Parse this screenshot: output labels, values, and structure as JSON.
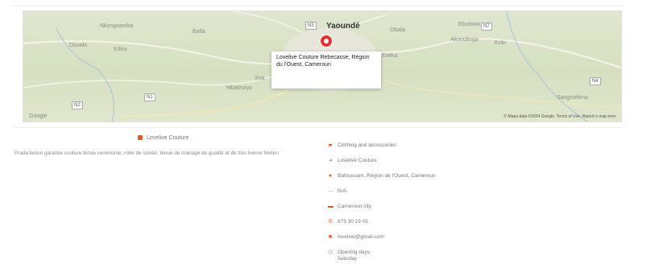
{
  "map": {
    "main_city": "Yaoundé",
    "info_window_title": "Lovelive Couture Rebecasse, Région du l'Ouest, Cameroun",
    "cities": [
      "Douala",
      "Edéa",
      "Nkongsamba",
      "Bafia",
      "Obala",
      "Soa",
      "Mbalmayo",
      "Ebolowa",
      "Akonolinga",
      "Sangmélima",
      "Kribi",
      "Eséka"
    ],
    "highway_markers": [
      "N3",
      "N1",
      "N2",
      "N4",
      "N7"
    ],
    "google_label": "Google",
    "attribution": "© Mapa data ©2024 Google, Terms of Use, Report a map error"
  },
  "listing": {
    "title": "Lovelive Couture",
    "description": "Prada kelvin garantie couture tenue ceremonie, robe de soirée, tenue de mariage de qualité et de tres bonne finition"
  },
  "details": {
    "items": [
      {
        "icon": "briefcase-icon",
        "text": "Clothing and accessories"
      },
      {
        "icon": "tag-icon",
        "text": "Lovelive Couture"
      },
      {
        "icon": "location-icon",
        "text": "Bafoussam, Région de l'Ouest, Cameroun"
      },
      {
        "icon": "flag-icon",
        "text": "N/A"
      },
      {
        "icon": "building-icon",
        "text": "Cameroun city"
      },
      {
        "icon": "phone-icon",
        "text": "675 30 19 05"
      },
      {
        "icon": "email-icon",
        "text": "lovelive@gmail.com"
      },
      {
        "icon": "clock-icon",
        "text": "Opening days",
        "sub": "Saturday"
      }
    ]
  }
}
